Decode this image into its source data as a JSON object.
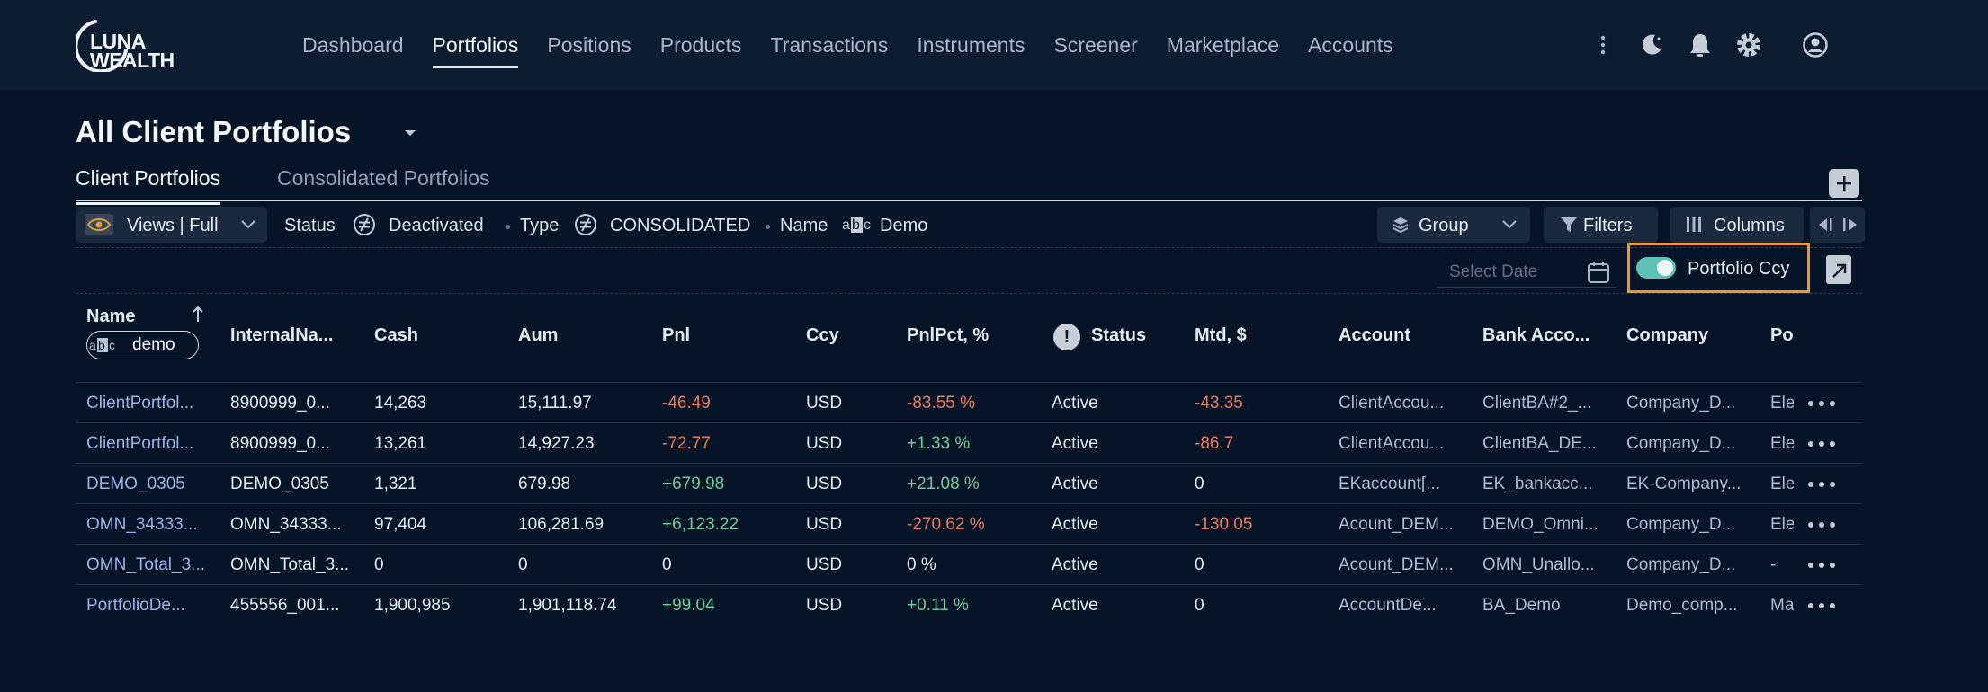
{
  "brand": {
    "line1": "LUNA",
    "line2": "WEALTH"
  },
  "nav": [
    {
      "label": "Dashboard",
      "active": false
    },
    {
      "label": "Portfolios",
      "active": true
    },
    {
      "label": "Positions",
      "active": false
    },
    {
      "label": "Products",
      "active": false
    },
    {
      "label": "Transactions",
      "active": false
    },
    {
      "label": "Instruments",
      "active": false
    },
    {
      "label": "Screener",
      "active": false
    },
    {
      "label": "Marketplace",
      "active": false
    },
    {
      "label": "Accounts",
      "active": false
    }
  ],
  "header_icons": [
    "more-vert-icon",
    "moon-icon",
    "bell-icon",
    "gear-icon",
    "user-icon"
  ],
  "page": {
    "title": "All Client Portfolios"
  },
  "tabs": [
    {
      "label": "Client Portfolios",
      "active": true
    },
    {
      "label": "Consolidated Portfolios",
      "active": false
    }
  ],
  "toolbar": {
    "views_label": "Views | Full",
    "filters": [
      {
        "label": "Status",
        "value": "Deactivated",
        "icon": "not-equal-icon"
      },
      {
        "label": "Type",
        "value": "CONSOLIDATED",
        "icon": "not-equal-icon"
      },
      {
        "label": "Name",
        "value": "Demo",
        "icon": "abc-icon"
      }
    ],
    "group_label": "Group",
    "filters_label": "Filters",
    "columns_label": "Columns"
  },
  "date": {
    "placeholder": "Select Date"
  },
  "ccy_toggle": {
    "label": "Portfolio Ccy",
    "on": true,
    "accent": "#5bc2b5",
    "highlight": "#f0962a"
  },
  "table": {
    "name_filter_value": "demo",
    "columns": {
      "name": "Name",
      "internal": "InternalNa...",
      "cash": "Cash",
      "aum": "Aum",
      "pnl": "Pnl",
      "ccy": "Ccy",
      "pnlpct": "PnlPct, %",
      "status": "Status",
      "mtd": "Mtd, $",
      "account": "Account",
      "bank": "Bank Acco...",
      "company": "Company",
      "po": "Po"
    },
    "rows": [
      {
        "name": "ClientPortfol...",
        "internal": "8900999_0...",
        "cash": "14,263",
        "aum": "15,111.97",
        "pnl": "-46.49",
        "ccy": "USD",
        "pnlpct": "-83.55 %",
        "status": "Active",
        "mtd": "-43.35",
        "account": "ClientAccou...",
        "bank": "ClientBA#2_...",
        "company": "Company_D...",
        "po": "Ele"
      },
      {
        "name": "ClientPortfol...",
        "internal": "8900999_0...",
        "cash": "13,261",
        "aum": "14,927.23",
        "pnl": "-72.77",
        "ccy": "USD",
        "pnlpct": "+1.33 %",
        "status": "Active",
        "mtd": "-86.7",
        "account": "ClientAccou...",
        "bank": "ClientBA_DE...",
        "company": "Company_D...",
        "po": "Ele"
      },
      {
        "name": "DEMO_0305",
        "internal": "DEMO_0305",
        "cash": "1,321",
        "aum": "679.98",
        "pnl": "+679.98",
        "ccy": "USD",
        "pnlpct": "+21.08 %",
        "status": "Active",
        "mtd": "0",
        "account": "EKaccount[...",
        "bank": "EK_bankacc...",
        "company": "EK-Company...",
        "po": "Ele"
      },
      {
        "name": "OMN_34333...",
        "internal": "OMN_34333...",
        "cash": "97,404",
        "aum": "106,281.69",
        "pnl": "+6,123.22",
        "ccy": "USD",
        "pnlpct": "-270.62 %",
        "status": "Active",
        "mtd": "-130.05",
        "account": "Acount_DEM...",
        "bank": "DEMO_Omni...",
        "company": "Company_D...",
        "po": "Ele"
      },
      {
        "name": "OMN_Total_3...",
        "internal": "OMN_Total_3...",
        "cash": "0",
        "aum": "0",
        "pnl": "0",
        "ccy": "USD",
        "pnlpct": "0 %",
        "status": "Active",
        "mtd": "0",
        "account": "Acount_DEM...",
        "bank": "OMN_Unallo...",
        "company": "Company_D...",
        "po": "-"
      },
      {
        "name": "PortfolioDe...",
        "internal": "455556_001...",
        "cash": "1,900,985",
        "aum": "1,901,118.74",
        "pnl": "+99.04",
        "ccy": "USD",
        "pnlpct": "+0.11 %",
        "status": "Active",
        "mtd": "0",
        "account": "AccountDe...",
        "bank": "BA_Demo",
        "company": "Demo_comp...",
        "po": "Ma"
      }
    ]
  }
}
